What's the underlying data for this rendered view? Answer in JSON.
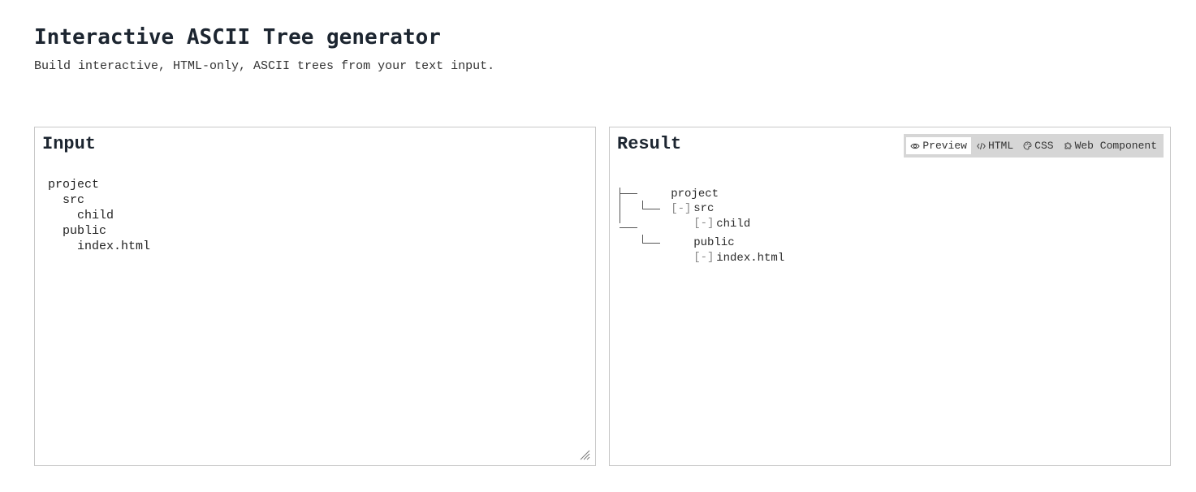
{
  "header": {
    "title": "Interactive ASCII Tree generator",
    "subtitle": "Build interactive, HTML-only, ASCII trees from your text input."
  },
  "input_panel": {
    "heading": "Input",
    "text": "project\n  src\n    child\n  public\n    index.html"
  },
  "result_panel": {
    "heading": "Result",
    "tabs": [
      {
        "label": "Preview",
        "icon": "eye-icon",
        "active": true
      },
      {
        "label": "HTML",
        "icon": "code-icon",
        "active": false
      },
      {
        "label": "CSS",
        "icon": "palette-icon",
        "active": false
      },
      {
        "label": "Web Component",
        "icon": "puzzle-icon",
        "active": false
      }
    ],
    "tree": {
      "root": {
        "label": "project",
        "toggle": "[-]"
      },
      "src": {
        "label": "src",
        "toggle": "[-]"
      },
      "child": {
        "label": "child"
      },
      "public": {
        "label": "public",
        "toggle": "[-]"
      },
      "index": {
        "label": "index.html"
      }
    }
  }
}
